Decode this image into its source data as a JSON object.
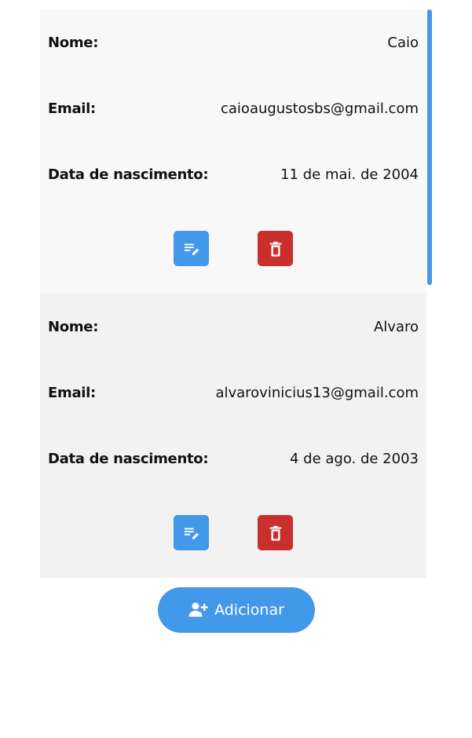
{
  "users": [
    {
      "name_label": "Nome:",
      "name": "Caio",
      "email_label": "Email:",
      "email": "caioaugustosbs@gmail.com",
      "birth_label": "Data de nascimento:",
      "birth": "11 de mai. de 2004",
      "edit_icon": "edit-note-icon",
      "delete_icon": "trash-icon"
    },
    {
      "name_label": "Nome:",
      "name": "Alvaro",
      "email_label": "Email:",
      "email": "alvarovinicius13@gmail.com",
      "birth_label": "Data de nascimento:",
      "birth": "4 de ago. de 2003",
      "edit_icon": "edit-note-icon",
      "delete_icon": "trash-icon"
    }
  ],
  "add_button": {
    "label": "Adicionar",
    "icon": "person-add-icon"
  },
  "colors": {
    "primary": "#4299ea",
    "danger": "#c9302c",
    "card_bg_1": "#f8f8f8",
    "card_bg_2": "#f2f2f2"
  }
}
